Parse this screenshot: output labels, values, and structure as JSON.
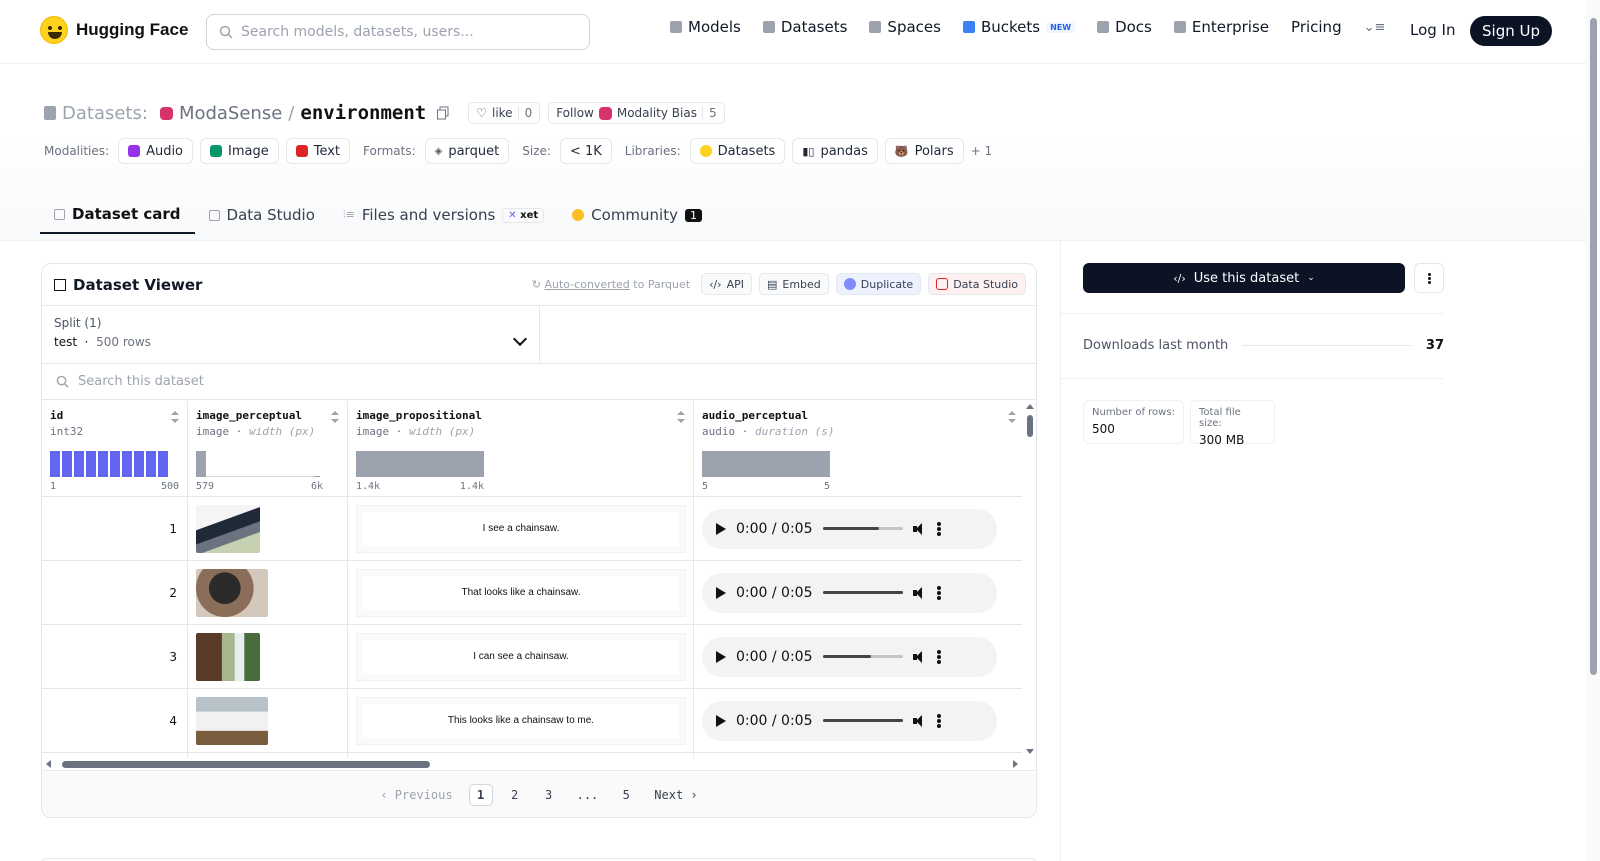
{
  "header": {
    "brand": "Hugging Face",
    "search_placeholder": "Search models, datasets, users...",
    "nav": [
      {
        "label": "Models",
        "icon": "cube-icon"
      },
      {
        "label": "Datasets",
        "icon": "database-icon"
      },
      {
        "label": "Spaces",
        "icon": "grid-icon"
      },
      {
        "label": "Buckets",
        "icon": "bucket-icon",
        "badge": "NEW"
      },
      {
        "label": "Docs",
        "icon": "book-icon"
      },
      {
        "label": "Enterprise",
        "icon": "enterprise-icon"
      },
      {
        "label": "Pricing"
      }
    ],
    "login": "Log In",
    "signup": "Sign Up"
  },
  "dataset": {
    "prefix": "Datasets:",
    "org": "ModaSense",
    "sep": "/",
    "name": "environment",
    "like_label": "like",
    "like_count": "0",
    "follow_label": "Follow",
    "follow_org": "Modality Bias",
    "follow_count": "5",
    "modalities_label": "Modalities:",
    "modalities": [
      "Audio",
      "Image",
      "Text"
    ],
    "formats_label": "Formats:",
    "formats": [
      "parquet"
    ],
    "size_label": "Size:",
    "size": "< 1K",
    "libraries_label": "Libraries:",
    "libraries": [
      "Datasets",
      "pandas",
      "Polars"
    ],
    "more": "+ 1"
  },
  "tabs": {
    "card": "Dataset card",
    "studio": "Data Studio",
    "files": "Files and versions",
    "xet": "xet",
    "community": "Community",
    "community_count": "1"
  },
  "viewer": {
    "title": "Dataset Viewer",
    "converted": "Auto-converted",
    "converted_suffix": " to Parquet",
    "api": "API",
    "embed": "Embed",
    "duplicate": "Duplicate",
    "data_studio": "Data Studio",
    "split_label": "Split (1)",
    "split_name": "test",
    "split_rows": "500 rows",
    "search_placeholder": "Search this dataset",
    "columns": [
      {
        "name": "id",
        "type": "int32",
        "min": "1",
        "max": "500"
      },
      {
        "name": "image_perceptual",
        "type": "image",
        "stat": "width (px)",
        "min": "579",
        "max": "6k"
      },
      {
        "name": "image_propositional",
        "type": "image",
        "stat": "width (px)",
        "min": "1.4k",
        "max": "1.4k"
      },
      {
        "name": "audio_perceptual",
        "type": "audio",
        "stat": "duration (s)",
        "min": "5",
        "max": "5"
      }
    ],
    "rows": [
      {
        "id": "1",
        "text": "I see a chainsaw.",
        "time": "0:00 / 0:05",
        "progress": 0.7
      },
      {
        "id": "2",
        "text": "That looks like a chainsaw.",
        "time": "0:00 / 0:05",
        "progress": 1.0
      },
      {
        "id": "3",
        "text": "I can see a chainsaw.",
        "time": "0:00 / 0:05",
        "progress": 0.6
      },
      {
        "id": "4",
        "text": "This looks like a chainsaw to me.",
        "time": "0:00 / 0:05",
        "progress": 1.0
      }
    ],
    "pager": {
      "prev": "Previous",
      "pages": [
        "1",
        "2",
        "3",
        "...",
        "5"
      ],
      "next": "Next"
    }
  },
  "sidebar": {
    "use_label": "Use this dataset",
    "downloads_label": "Downloads last month",
    "downloads": "37",
    "rows_label": "Number of rows:",
    "rows": "500",
    "filesize_label": "Total file size:",
    "filesize": "300 MB"
  }
}
